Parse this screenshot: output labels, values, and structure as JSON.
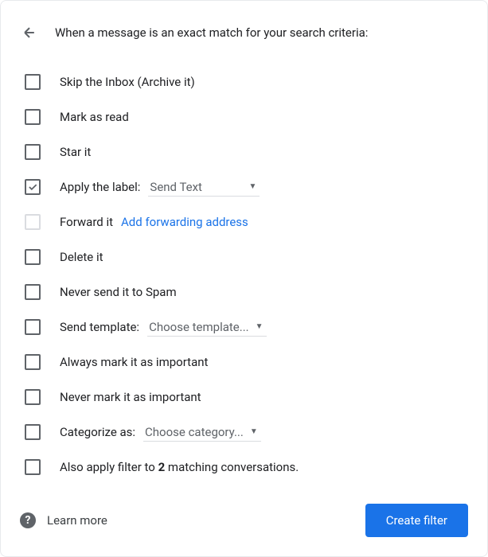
{
  "title": "When a message is an exact match for your search criteria:",
  "options": {
    "skip_inbox": "Skip the Inbox (Archive it)",
    "mark_read": "Mark as read",
    "star_it": "Star it",
    "apply_label": "Apply the label:",
    "apply_label_value": "Send Text",
    "forward_it": "Forward it",
    "forward_link": "Add forwarding address",
    "delete_it": "Delete it",
    "never_spam": "Never send it to Spam",
    "send_template": "Send template:",
    "send_template_value": "Choose template...",
    "always_important": "Always mark it as important",
    "never_important": "Never mark it as important",
    "categorize": "Categorize as:",
    "categorize_value": "Choose category...",
    "also_apply_prefix": "Also apply filter to ",
    "also_apply_count": "2",
    "also_apply_suffix": " matching conversations."
  },
  "footer": {
    "learn_more": "Learn more",
    "create_button": "Create filter"
  }
}
